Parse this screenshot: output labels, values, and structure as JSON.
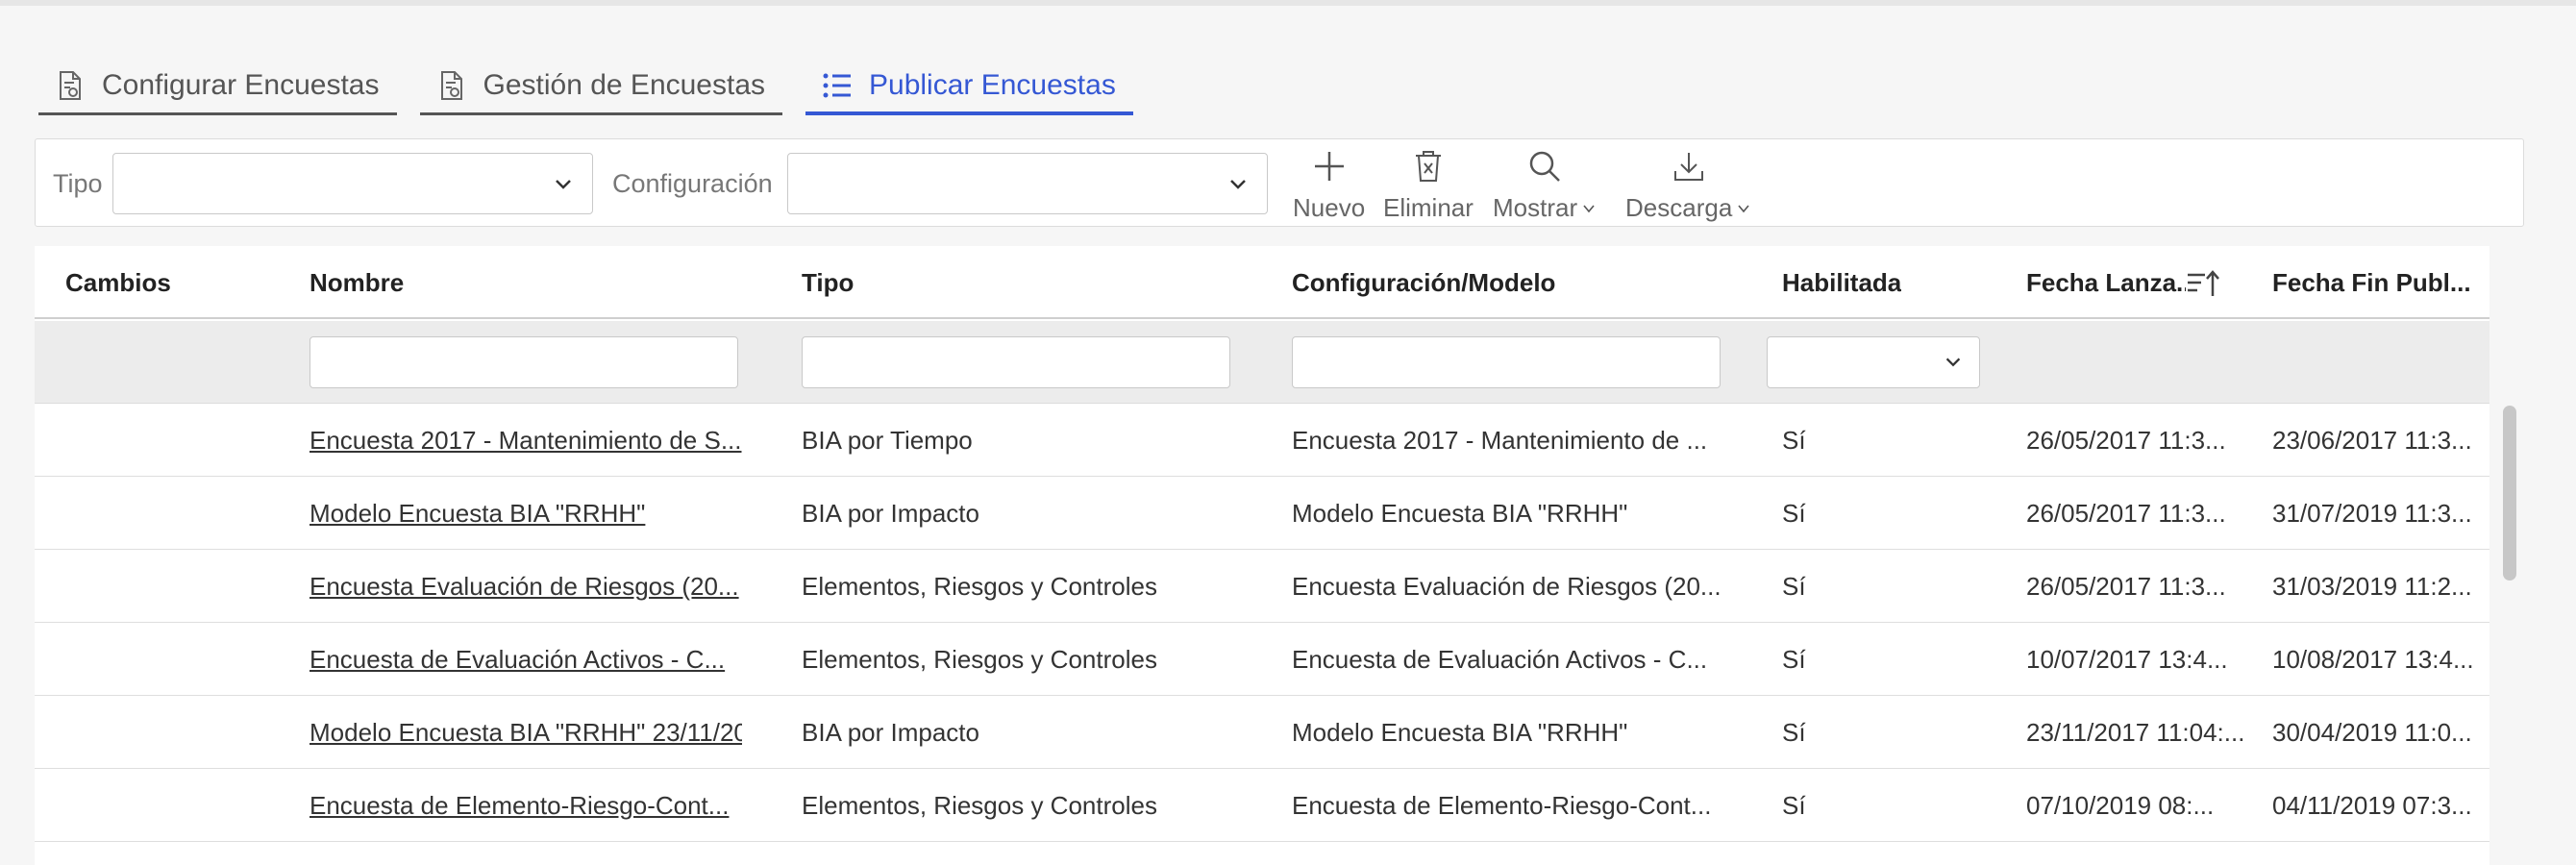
{
  "tabs": [
    {
      "label": "Configurar Encuestas",
      "icon": "document-settings-icon"
    },
    {
      "label": "Gestión de Encuestas",
      "icon": "document-settings-icon"
    },
    {
      "label": "Publicar Encuestas",
      "icon": "list-icon",
      "active": true
    }
  ],
  "toolbar": {
    "tipo_label": "Tipo",
    "tipo_value": "",
    "config_label": "Configuración",
    "config_value": "",
    "nuevo": "Nuevo",
    "eliminar": "Eliminar",
    "mostrar": "Mostrar",
    "descarga": "Descarga"
  },
  "grid": {
    "columns": [
      "Cambios",
      "Nombre",
      "Tipo",
      "Configuración/Modelo",
      "Habilitada",
      "Fecha Lanza...",
      "Fecha Fin Publ..."
    ],
    "rows": [
      {
        "nombre": "Encuesta 2017 - Mantenimiento de S...",
        "tipo": "BIA por Tiempo",
        "config": "Encuesta 2017 - Mantenimiento de ...",
        "habilitada": "Sí",
        "lanza": "26/05/2017 11:3...",
        "fin": "23/06/2017 11:3..."
      },
      {
        "nombre": "Modelo Encuesta BIA \"RRHH\"",
        "tipo": "BIA por Impacto",
        "config": "Modelo Encuesta BIA \"RRHH\"",
        "habilitada": "Sí",
        "lanza": "26/05/2017 11:3...",
        "fin": "31/07/2019 11:3..."
      },
      {
        "nombre": "Encuesta Evaluación de Riesgos (20...",
        "tipo": "Elementos, Riesgos y Controles",
        "config": "Encuesta Evaluación de Riesgos (20...",
        "habilitada": "Sí",
        "lanza": "26/05/2017 11:3...",
        "fin": "31/03/2019 11:2..."
      },
      {
        "nombre": "Encuesta de Evaluación Activos - C...",
        "tipo": "Elementos, Riesgos y Controles",
        "config": "Encuesta de Evaluación Activos - C...",
        "habilitada": "Sí",
        "lanza": "10/07/2017 13:4...",
        "fin": "10/08/2017 13:4..."
      },
      {
        "nombre": "Modelo Encuesta BIA \"RRHH\" 23/11/20...",
        "tipo": "BIA por Impacto",
        "config": "Modelo Encuesta BIA \"RRHH\"",
        "habilitada": "Sí",
        "lanza": "23/11/2017 11:04:...",
        "fin": "30/04/2019 11:0..."
      },
      {
        "nombre": "Encuesta de Elemento-Riesgo-Cont...",
        "tipo": "Elementos, Riesgos y Controles",
        "config": "Encuesta de Elemento-Riesgo-Cont...",
        "habilitada": "Sí",
        "lanza": "07/10/2019 08:...",
        "fin": "04/11/2019 07:3..."
      }
    ]
  },
  "colors": {
    "accent": "#3558d4",
    "text": "#333333",
    "muted": "#777777"
  }
}
